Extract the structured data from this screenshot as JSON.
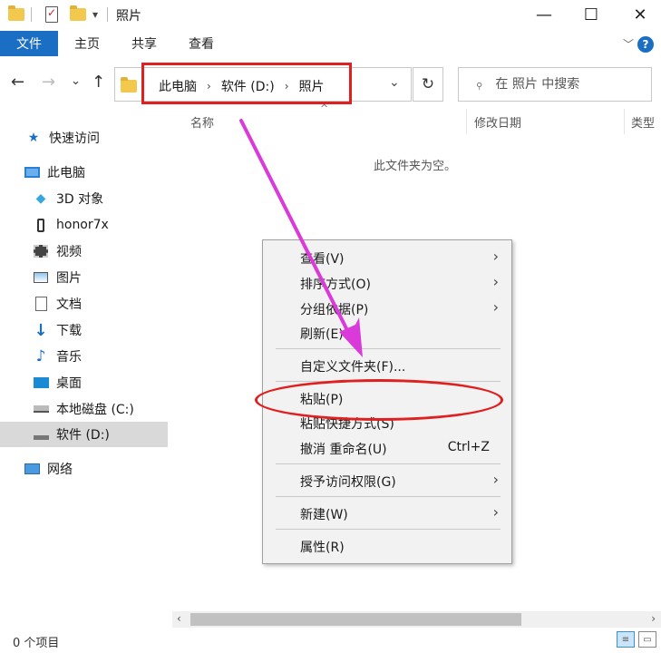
{
  "window": {
    "title": "照片",
    "controls": {
      "minimize": "—",
      "maximize": "☐",
      "close": "✕"
    }
  },
  "quick_access_toolbar": {
    "dropdown": "▾"
  },
  "ribbon": {
    "tabs": [
      "文件",
      "主页",
      "共享",
      "查看"
    ],
    "help": "?",
    "collapse": "﹀",
    "accent": "#1a6fc4"
  },
  "nav": {
    "back": "←",
    "forward": "→",
    "recent": "⌄",
    "up": "↑",
    "breadcrumbs": [
      "此电脑",
      "软件 (D:)",
      "照片"
    ],
    "separator": "›",
    "address_dropdown": "⌄",
    "refresh": "↻"
  },
  "search": {
    "placeholder": "在 照片 中搜索",
    "icon": "⌕"
  },
  "columns": {
    "name": "名称",
    "modified": "修改日期",
    "type": "类型",
    "sort_indicator": "^"
  },
  "empty_message": "此文件夹为空。",
  "sidebar": {
    "items": [
      {
        "label": "快速访问",
        "icon": "star-icon"
      },
      {
        "label": "此电脑",
        "icon": "computer-icon"
      },
      {
        "label": "3D 对象",
        "icon": "cube-icon"
      },
      {
        "label": "honor7x",
        "icon": "phone-icon"
      },
      {
        "label": "视频",
        "icon": "video-icon"
      },
      {
        "label": "图片",
        "icon": "picture-icon"
      },
      {
        "label": "文档",
        "icon": "document-icon"
      },
      {
        "label": "下载",
        "icon": "download-icon"
      },
      {
        "label": "音乐",
        "icon": "music-icon"
      },
      {
        "label": "桌面",
        "icon": "desktop-icon"
      },
      {
        "label": "本地磁盘 (C:)",
        "icon": "drive-c-icon"
      },
      {
        "label": "软件 (D:)",
        "icon": "drive-d-icon",
        "selected": true
      },
      {
        "label": "网络",
        "icon": "network-icon"
      }
    ]
  },
  "context_menu": {
    "items": [
      {
        "label": "查看(V)",
        "submenu": true
      },
      {
        "label": "排序方式(O)",
        "submenu": true
      },
      {
        "label": "分组依据(P)",
        "submenu": true
      },
      {
        "label": "刷新(E)"
      },
      {
        "label": "自定义文件夹(F)..."
      },
      {
        "label": "粘贴(P)"
      },
      {
        "label": "粘贴快捷方式(S)"
      },
      {
        "label": "撤消 重命名(U)",
        "shortcut": "Ctrl+Z"
      },
      {
        "label": "授予访问权限(G)",
        "submenu": true
      },
      {
        "label": "新建(W)",
        "submenu": true
      },
      {
        "label": "属性(R)"
      }
    ],
    "submenu_arrow": "›"
  },
  "status": {
    "item_count": "0 个项目"
  },
  "scrollbar": {
    "left": "‹",
    "right": "›"
  },
  "view_buttons": {
    "details": "≡",
    "large_icons": "▭"
  },
  "annotation_color": "#e02020",
  "arrow_color": "#d93ad9"
}
